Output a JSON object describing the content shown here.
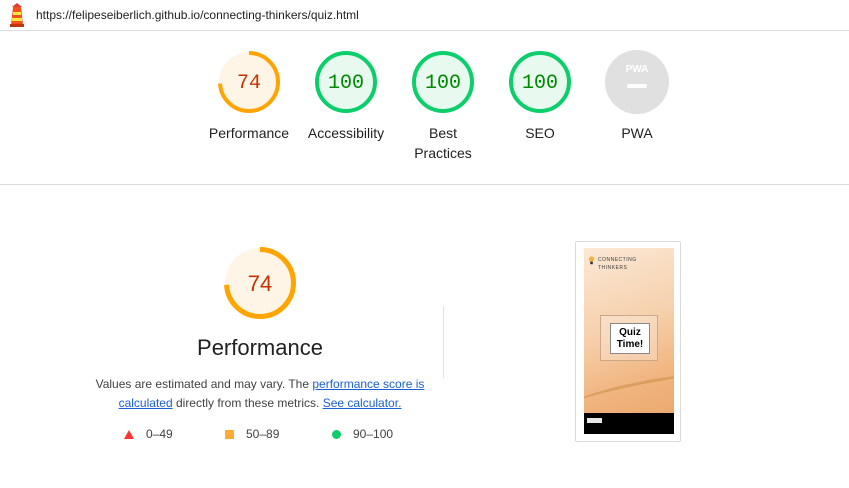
{
  "browser": {
    "url": "https://felipeseiberlich.github.io/connecting-thinkers/quiz.html",
    "logo_icon": "lighthouse-icon"
  },
  "gauges": [
    {
      "label": "Performance",
      "score": 74,
      "display": "74",
      "status": "average"
    },
    {
      "label": "Accessibility",
      "score": 100,
      "display": "100",
      "status": "pass"
    },
    {
      "label": "Best Practices",
      "score": 100,
      "display": "100",
      "status": "pass"
    },
    {
      "label": "SEO",
      "score": 100,
      "display": "100",
      "status": "pass"
    },
    {
      "label": "PWA",
      "score": null,
      "display": "PWA",
      "status": "na"
    }
  ],
  "performance": {
    "score": 74,
    "display": "74",
    "title": "Performance",
    "desc_text_1": "Values are estimated and may vary. The ",
    "link_score": "performance score is calculated",
    "desc_text_2": " directly from these metrics. ",
    "link_calculator": "See calculator."
  },
  "legend": [
    {
      "range": "0–49",
      "shape": "triangle",
      "color": "#ff3333"
    },
    {
      "range": "50–89",
      "shape": "square",
      "color": "#ffaa33"
    },
    {
      "range": "90–100",
      "shape": "circle",
      "color": "#0cce6b"
    }
  ],
  "screenshot": {
    "brand_line1": "CONNECTING",
    "brand_line2": "THINKERS",
    "quiz_line1": "Quiz",
    "quiz_line2": "Time!"
  },
  "colors": {
    "pass": "#0cce6b",
    "pass_text": "#008800",
    "average": "#ffa400",
    "average_text": "#c33300",
    "na": "#e0e0e0"
  }
}
